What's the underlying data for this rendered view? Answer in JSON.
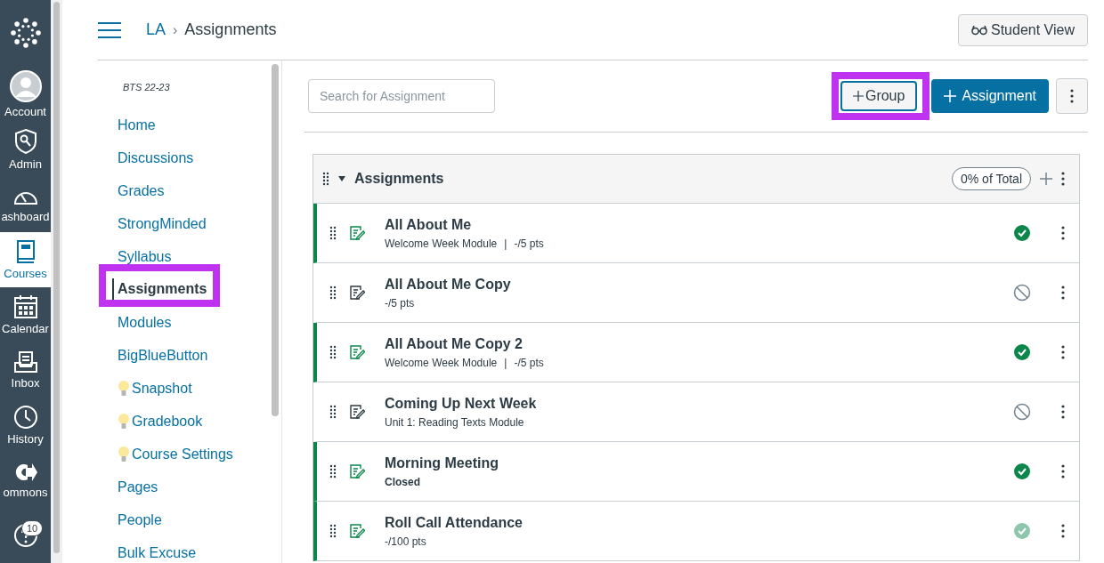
{
  "global_nav": {
    "items": [
      {
        "kind": "logo",
        "selected": false
      },
      {
        "kind": "account",
        "label": "Account",
        "selected": false
      },
      {
        "kind": "admin",
        "label": "Admin",
        "selected": false
      },
      {
        "kind": "dashboard",
        "label": "ashboard",
        "selected": false
      },
      {
        "kind": "courses",
        "label": "Courses",
        "selected": true
      },
      {
        "kind": "calendar",
        "label": "Calendar",
        "selected": false
      },
      {
        "kind": "inbox",
        "label": "Inbox",
        "selected": false
      },
      {
        "kind": "history",
        "label": "History",
        "selected": false
      },
      {
        "kind": "commons",
        "label": "ommons",
        "selected": false
      },
      {
        "kind": "help",
        "badge": "10",
        "selected": false
      }
    ]
  },
  "breadcrumb": {
    "course": "LA",
    "separator": "›",
    "page": "Assignments"
  },
  "student_view_button": "Student View",
  "course_nav": {
    "term": "BTS 22-23",
    "items": [
      {
        "label": "Home",
        "selected": false
      },
      {
        "label": "Discussions",
        "selected": false
      },
      {
        "label": "Grades",
        "selected": false
      },
      {
        "label": "StrongMinded",
        "selected": false
      },
      {
        "label": "Syllabus",
        "selected": false
      },
      {
        "label": "Assignments",
        "selected": true,
        "highlighted": true
      },
      {
        "label": "Modules",
        "selected": false
      },
      {
        "label": "BigBlueButton",
        "selected": false
      },
      {
        "label": "Snapshot",
        "selected": false,
        "bulb": true
      },
      {
        "label": "Gradebook",
        "selected": false,
        "bulb": true
      },
      {
        "label": "Course Settings",
        "selected": false,
        "bulb": true
      },
      {
        "label": "Pages",
        "selected": false
      },
      {
        "label": "People",
        "selected": false
      },
      {
        "label": "Bulk Excuse",
        "selected": false
      }
    ]
  },
  "toolbar": {
    "search_placeholder": "Search for Assignment",
    "group_button": {
      "label": "Group",
      "highlighted": true
    },
    "assignment_button": "Assignment"
  },
  "group": {
    "title": "Assignments",
    "expanded": true,
    "weight": "0% of Total",
    "assignments": [
      {
        "title": "All About Me",
        "published": true,
        "locked": false,
        "meta": [
          {
            "text": "Welcome Week Module",
            "bold": false
          },
          {
            "text": "-/5 pts",
            "bold": false
          }
        ]
      },
      {
        "title": "All About Me Copy",
        "published": false,
        "locked": false,
        "meta": [
          {
            "text": "-/5 pts",
            "bold": false
          }
        ]
      },
      {
        "title": "All About Me Copy 2",
        "published": true,
        "locked": false,
        "meta": [
          {
            "text": "Welcome Week Module",
            "bold": false
          },
          {
            "text": "-/5 pts",
            "bold": false
          }
        ]
      },
      {
        "title": "Coming Up Next Week",
        "published": false,
        "locked": false,
        "meta": [
          {
            "text": "Unit 1: Reading Texts Module",
            "bold": false
          }
        ]
      },
      {
        "title": "Morning Meeting",
        "published": true,
        "locked": false,
        "meta": [
          {
            "text": "Closed",
            "bold": true
          }
        ]
      },
      {
        "title": "Roll Call Attendance",
        "published": true,
        "locked": true,
        "meta": [
          {
            "text": "-/100 pts",
            "bold": false
          }
        ]
      }
    ],
    "meta_separator": "|"
  }
}
